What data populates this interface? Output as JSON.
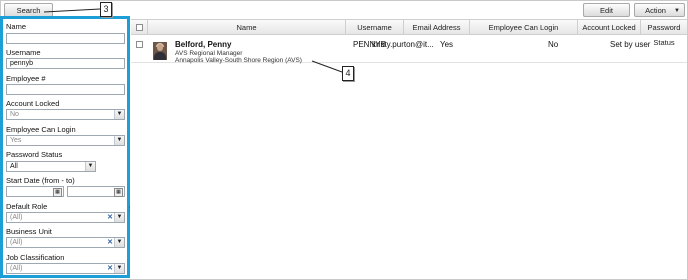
{
  "toolbar": {
    "search_label": "Search",
    "edit_label": "Edit",
    "action_label": "Action"
  },
  "callouts": {
    "sidebar": "3",
    "row": "4"
  },
  "filters": {
    "name_label": "Name",
    "name_value": "",
    "username_label": "Username",
    "username_value": "pennyb",
    "employee_label": "Employee #",
    "employee_value": "",
    "account_locked_label": "Account Locked",
    "account_locked_value": "No",
    "employee_login_label": "Employee Can Login",
    "employee_login_value": "Yes",
    "password_status_label": "Password Status",
    "password_status_value": "All",
    "start_date_label": "Start Date (from - to)",
    "default_role_label": "Default Role",
    "default_role_value": "(All)",
    "business_unit_label": "Business Unit",
    "business_unit_value": "(All)",
    "job_class_label": "Job Classification",
    "job_class_value": "(All)"
  },
  "grid": {
    "columns": [
      "Name",
      "Username",
      "Email Address",
      "Employee Can Login",
      "Account Locked",
      "Password Status"
    ],
    "rows": [
      {
        "name": "Belford, Penny",
        "title": "AVS Regional Manager",
        "region": "Annapolis Valley-South Shore Region (AVS)",
        "username": "PENNYB",
        "email": "kristy.purton@it...",
        "can_login": "Yes",
        "locked": "No",
        "password_status": "Set by user"
      }
    ]
  },
  "colors": {
    "sidebar_border": "#1b9fd6"
  }
}
